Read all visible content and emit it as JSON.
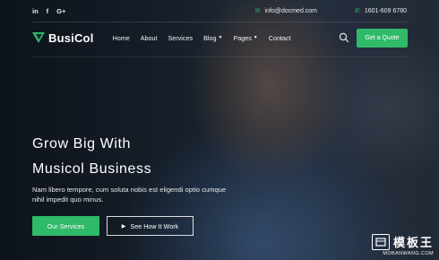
{
  "topbar": {
    "social": [
      "in",
      "f",
      "G+"
    ],
    "email": "info@docmed.com",
    "phone": "1601-609 6780"
  },
  "nav": {
    "logo_text": "BusiCol",
    "items": [
      {
        "label": "Home",
        "has_caret": false
      },
      {
        "label": "About",
        "has_caret": false
      },
      {
        "label": "Services",
        "has_caret": false
      },
      {
        "label": "Blog",
        "has_caret": true
      },
      {
        "label": "Pages",
        "has_caret": true
      },
      {
        "label": "Contact",
        "has_caret": false
      }
    ],
    "cta_label": "Get a Quote"
  },
  "hero": {
    "title_line1": "Grow Big With",
    "title_line2": "Musicol Business",
    "text": "Nam libero tempore, cum soluta nobis est eligendi optio cumque nihil impedit quo minus.",
    "primary_btn": "Our Services",
    "secondary_btn": "See How It Work"
  },
  "watermark": {
    "cn": "模板王",
    "url": "MOBANWANG.COM"
  },
  "colors": {
    "accent": "#2fba6a"
  }
}
